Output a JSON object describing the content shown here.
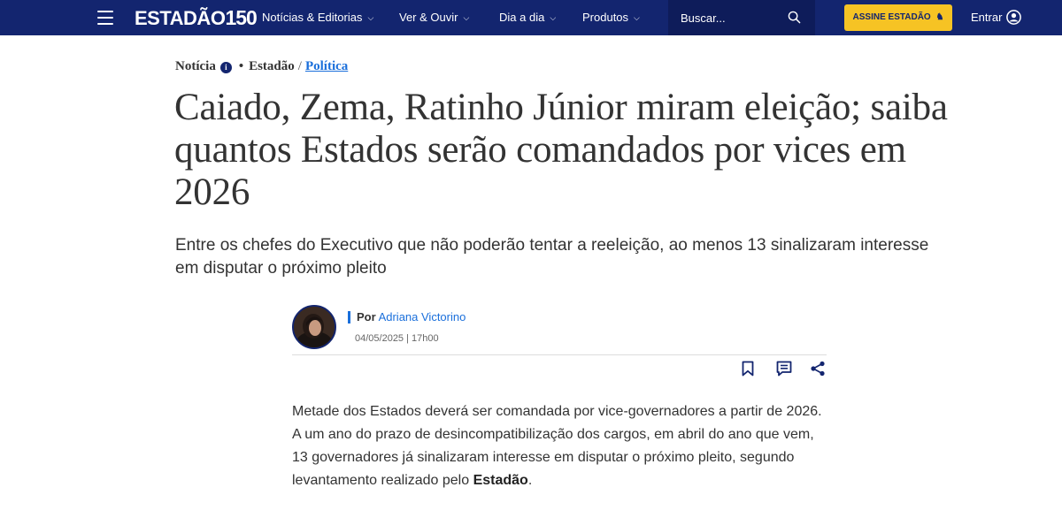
{
  "header": {
    "logo_text": "ESTADÃO",
    "logo_number": "150",
    "nav": [
      {
        "label": "Notícias & Editorias"
      },
      {
        "label": "Ver & Ouvir"
      },
      {
        "label": "Dia a dia"
      },
      {
        "label": "Produtos"
      }
    ],
    "search_placeholder": "Buscar...",
    "subscribe_label": "ASSINE ESTADÃO",
    "login_label": "Entrar",
    "colors": {
      "bar": "#13256f",
      "search_bg": "#0e1c5a",
      "subscribe_bg": "#f6c324"
    }
  },
  "article": {
    "type_label": "Notícia",
    "source": "Estadão",
    "separator": "/",
    "section": "Política",
    "headline": "Caiado, Zema, Ratinho Júnior miram eleição; saiba quantos Estados serão comandados por vices em 2026",
    "subtitle": "Entre os chefes do Executivo que não poderão tentar a reeleição, ao menos 13 sinalizaram interesse em disputar o próximo pleito",
    "byline_prefix": "Por",
    "author": "Adriana Victorino",
    "date": "04/05/2025",
    "time": "17h00",
    "body_part1": "Metade dos Estados deverá ser comandada por vice-governadores a partir de 2026. A um ano do prazo de desincompatibilização dos cargos, em abril do ano que vem, 13 governadores já sinalizaram interesse em disputar o próximo pleito, segundo levantamento realizado pelo ",
    "body_bold": "Estadão",
    "body_end": ".",
    "link_color": "#1a6fdb"
  },
  "icons": {
    "menu": "hamburger-icon",
    "search": "search-icon",
    "login": "user-icon",
    "info": "info-icon",
    "save": "bookmark-icon",
    "comments": "comment-icon",
    "share": "share-icon"
  }
}
